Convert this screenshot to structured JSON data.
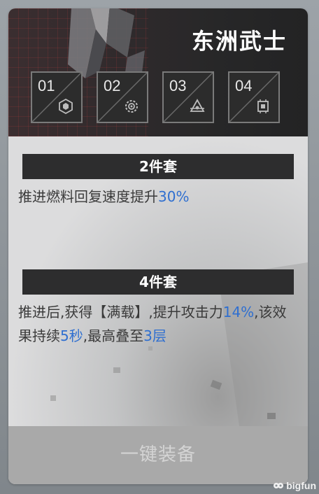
{
  "header": {
    "title": "东洲武士"
  },
  "slots": [
    {
      "label": "01",
      "icon": "hexagon-shield-icon"
    },
    {
      "label": "02",
      "icon": "gear-target-icon"
    },
    {
      "label": "03",
      "icon": "triangle-eye-icon"
    },
    {
      "label": "04",
      "icon": "microchip-icon"
    }
  ],
  "set2": {
    "heading": "2件套",
    "desc_pre": "推进燃料回复速度提升",
    "desc_value": "30%"
  },
  "set4": {
    "heading": "4件套",
    "desc_a": "推进后,获得【满载】,提升攻击力",
    "val_attack": "14%",
    "desc_b": ",该效果持续",
    "val_duration": "5秒",
    "desc_c": ",最高叠至",
    "val_stack": "3层"
  },
  "equip_button": "一键装备",
  "watermark": "bigfun",
  "colors": {
    "highlight": "#2f6fd0",
    "bar": "#2d2d2e",
    "equip_bg": "#a9a9a9"
  }
}
